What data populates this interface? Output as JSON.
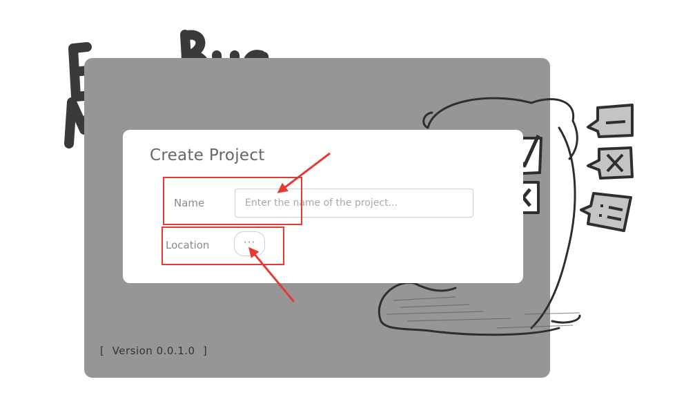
{
  "logo": {
    "line1": "Easy Bug",
    "line2": "Manager"
  },
  "dialog": {
    "title": "Create Project",
    "name_label": "Name",
    "name_placeholder": "Enter the name of the project...",
    "name_value": "",
    "location_label": "Location",
    "browse_label": "···"
  },
  "version": {
    "bracket_left": "[",
    "text": "Version 0.0.1.0",
    "bracket_right": "]"
  },
  "colors": {
    "window_bg": "#969696",
    "dialog_bg": "#ffffff",
    "annotation": "#e53935",
    "text_gray": "#8a8a8a"
  },
  "icons": {
    "check_bubble": "check-speech-bubble-icon",
    "x_bubble": "x-speech-bubble-icon",
    "minus_bubble": "minus-speech-bubble-icon",
    "list_bubble": "list-speech-bubble-icon"
  }
}
